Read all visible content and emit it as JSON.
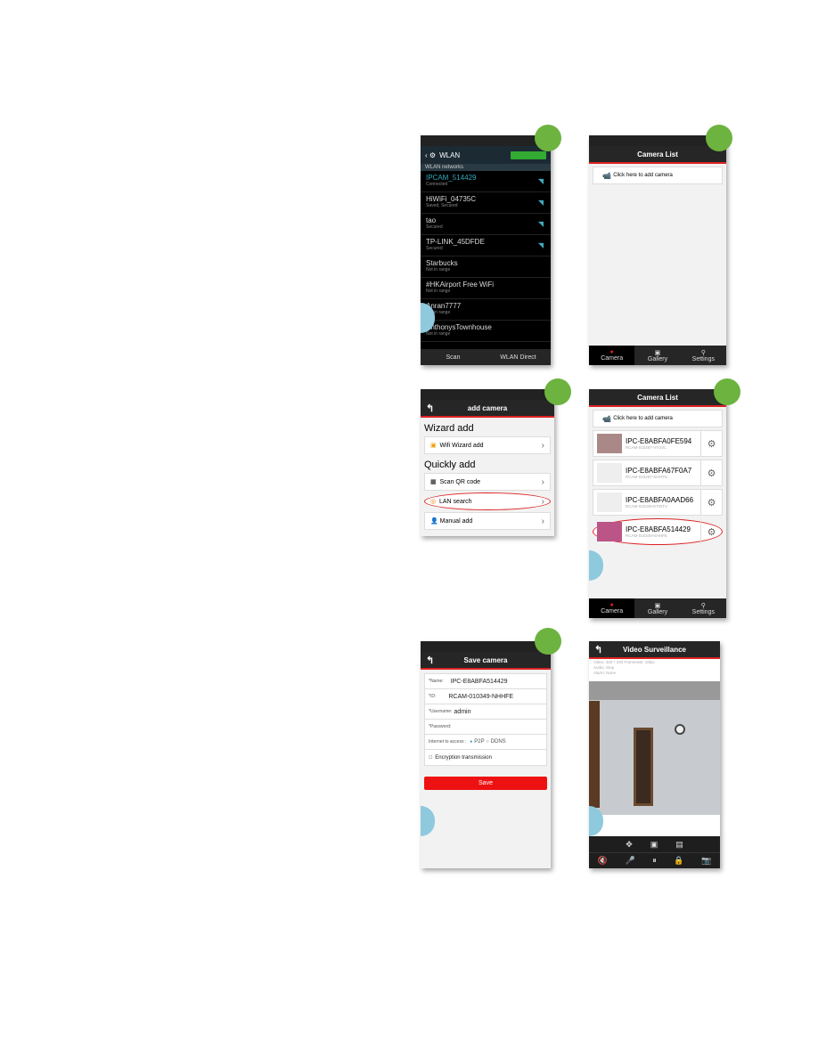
{
  "wlan": {
    "title": "WLAN",
    "section": "WLAN networks",
    "networks": [
      {
        "name": "IPCAM_514429",
        "status": "Connected"
      },
      {
        "name": "HiWiFi_04735C",
        "status": "Saved, Secured"
      },
      {
        "name": "tao",
        "status": "Secured"
      },
      {
        "name": "TP-LINK_45DFDE",
        "status": "Secured"
      },
      {
        "name": "Starbucks",
        "status": "Not in range"
      },
      {
        "name": "#HKAirport Free WiFi",
        "status": "Not in range"
      },
      {
        "name": "Anran7777",
        "status": "Not in range"
      },
      {
        "name": "AnthonysTownhouse",
        "status": "Not in range"
      }
    ],
    "scan": "Scan",
    "direct": "WLAN Direct"
  },
  "camlist": {
    "title": "Camera List",
    "add": "Click here to add camera",
    "tabs": [
      "Camera",
      "Gallery",
      "Settings"
    ],
    "cameras": [
      {
        "name": "IPC-E8ABFA0FE594",
        "id": "RCAM-010267-VTUVL"
      },
      {
        "name": "IPC-E8ABFA67F0A7",
        "id": "RCAM-010267-SHHTG"
      },
      {
        "name": "IPC-E8ABFA0AAD66",
        "id": "RCAM-010345-ETWTV"
      },
      {
        "name": "IPC-E8ABFA514429",
        "id": "RCAM-010349-NHHFE"
      }
    ]
  },
  "addcam": {
    "title": "add camera",
    "wizard": "Wizard add",
    "wifi": "Wifi Wizard add",
    "quick": "Quickly add",
    "scan": "Scan QR code",
    "lan": "LAN search",
    "manual": "Manual add"
  },
  "save": {
    "title": "Save camera",
    "name_l": "*Name:",
    "name": "IPC-E8ABFA514429",
    "id_l": "*ID:",
    "id": "RCAM-010349-NHHFE",
    "user_l": "*Username:",
    "user": "admin",
    "pw_l": "*Password:",
    "access": "Internet to access :",
    "p2p": "P2P",
    "ddns": "DDNS",
    "enc": "Encryption transmission",
    "btn": "Save"
  },
  "video": {
    "title": "Video Surveillance",
    "video": "Video: 320 * 240  Framerate: 15fps",
    "audio": "Audio: Stop",
    "alarm": "Alarm: None"
  },
  "colors": {
    "accent": "#d22222",
    "badge": "#6db33f"
  }
}
